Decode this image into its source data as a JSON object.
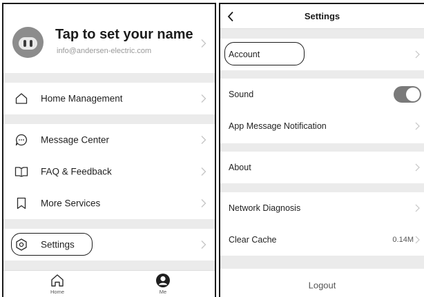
{
  "me_screen": {
    "profile": {
      "name": "Tap to set your name",
      "email": "info@andersen-electric.com"
    },
    "menu": {
      "home_management": "Home Management",
      "message_center": "Message Center",
      "faq_feedback": "FAQ & Feedback",
      "more_services": "More Services",
      "settings": "Settings"
    },
    "tabs": {
      "home": "Home",
      "me": "Me"
    }
  },
  "settings_screen": {
    "title": "Settings",
    "items": {
      "account": "Account",
      "sound": "Sound",
      "app_message_notification": "App Message Notification",
      "about": "About",
      "network_diagnosis": "Network Diagnosis",
      "clear_cache": "Clear Cache",
      "cache_size": "0.14M"
    },
    "sound_enabled": true,
    "logout": "Logout"
  },
  "icons": {
    "avatar": "robot-avatar-icon",
    "home_management": "house-outline-icon",
    "message_center": "chat-bubble-icon",
    "faq_feedback": "open-book-icon",
    "more_services": "bookmark-icon",
    "settings": "hexagon-gear-icon",
    "chevron": "chevron-right-icon",
    "back": "chevron-left-icon",
    "tab_home": "house-icon",
    "tab_me": "user-circle-icon"
  },
  "colors": {
    "background": "#ebebeb",
    "toggle_on": "#7a7a7a",
    "muted_text": "#999999"
  }
}
